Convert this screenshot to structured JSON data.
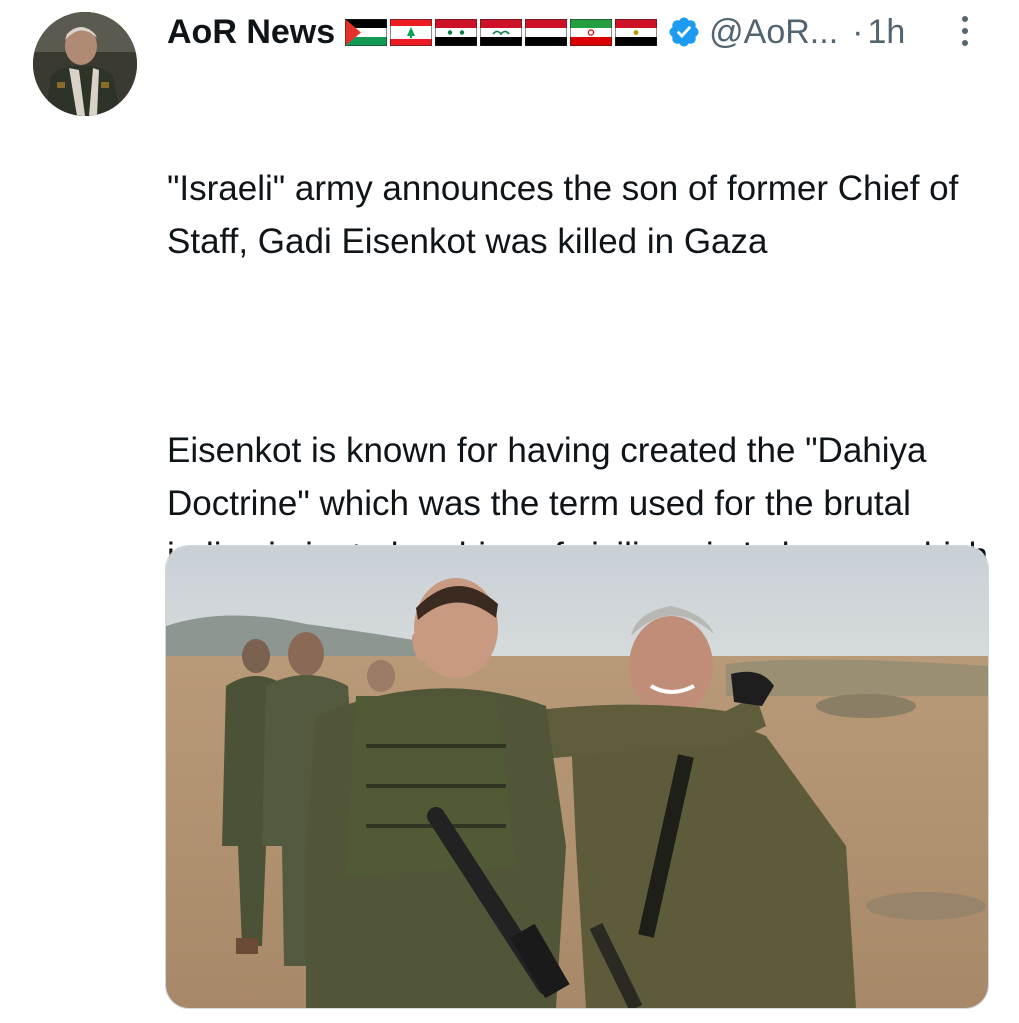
{
  "tweet": {
    "author": {
      "display_name": "AoR News",
      "flags": [
        "palestine-flag",
        "lebanon-flag",
        "syria-flag",
        "iraq-flag",
        "yemen-flag",
        "iran-flag",
        "egypt-flag"
      ],
      "verified_icon": "verified-badge-icon",
      "handle": "@AoR...",
      "avatar_icon": "profile-avatar"
    },
    "separator": "·",
    "time": "1h",
    "more_icon": "more-vertical-icon",
    "text_paragraphs": [
      "\"Israeli\" army announces the son of former Chief of Staff, Gadi Eisenkot was killed in Gaza",
      "Eisenkot is known for having created the \"Dahiya Doctrine\" which was the term used for the brutal indiscriminate bombing of civilians in Lebanon, which is being repeated in Gaza now"
    ],
    "media": {
      "kind": "photo"
    },
    "colors": {
      "text": "#0f1419",
      "secondary": "#536471",
      "verified": "#1d9bf0"
    }
  }
}
